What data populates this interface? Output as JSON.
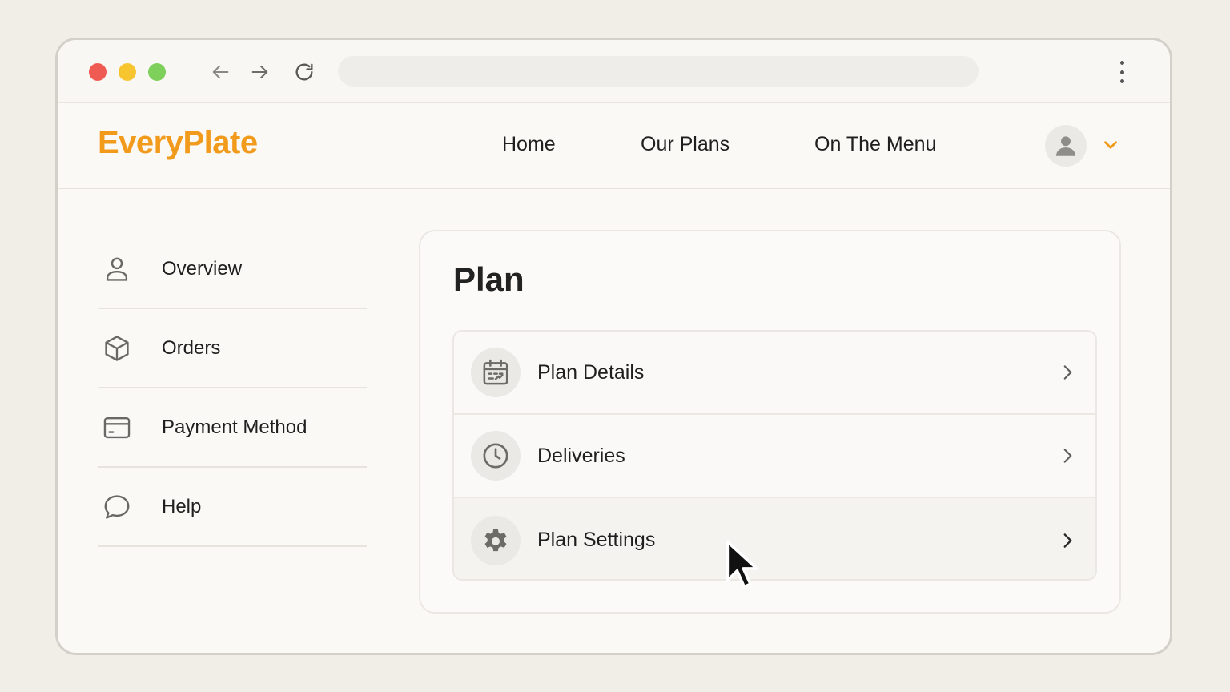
{
  "brand": {
    "logo_text": "EveryPlate",
    "accent_color": "#f29a1b"
  },
  "browser": {
    "window_controls": [
      "close",
      "minimize",
      "maximize"
    ],
    "icons": [
      "back-arrow-icon",
      "forward-arrow-icon",
      "reload-icon",
      "more-vertical-icon"
    ]
  },
  "header": {
    "nav": [
      {
        "label": "Home"
      },
      {
        "label": "Our Plans"
      },
      {
        "label": "On The Menu"
      }
    ],
    "account_icon": "user-icon",
    "menu_icon": "chevron-down-icon"
  },
  "sidebar": {
    "items": [
      {
        "label": "Overview",
        "icon": "user-icon"
      },
      {
        "label": "Orders",
        "icon": "box-icon"
      },
      {
        "label": "Payment Method",
        "icon": "credit-card-icon"
      },
      {
        "label": "Help",
        "icon": "chat-bubble-icon"
      }
    ]
  },
  "main": {
    "title": "Plan",
    "rows": [
      {
        "label": "Plan Details",
        "icon": "calendar-icon"
      },
      {
        "label": "Deliveries",
        "icon": "clock-icon"
      },
      {
        "label": "Plan Settings",
        "icon": "gear-icon",
        "hovered": true
      }
    ]
  }
}
